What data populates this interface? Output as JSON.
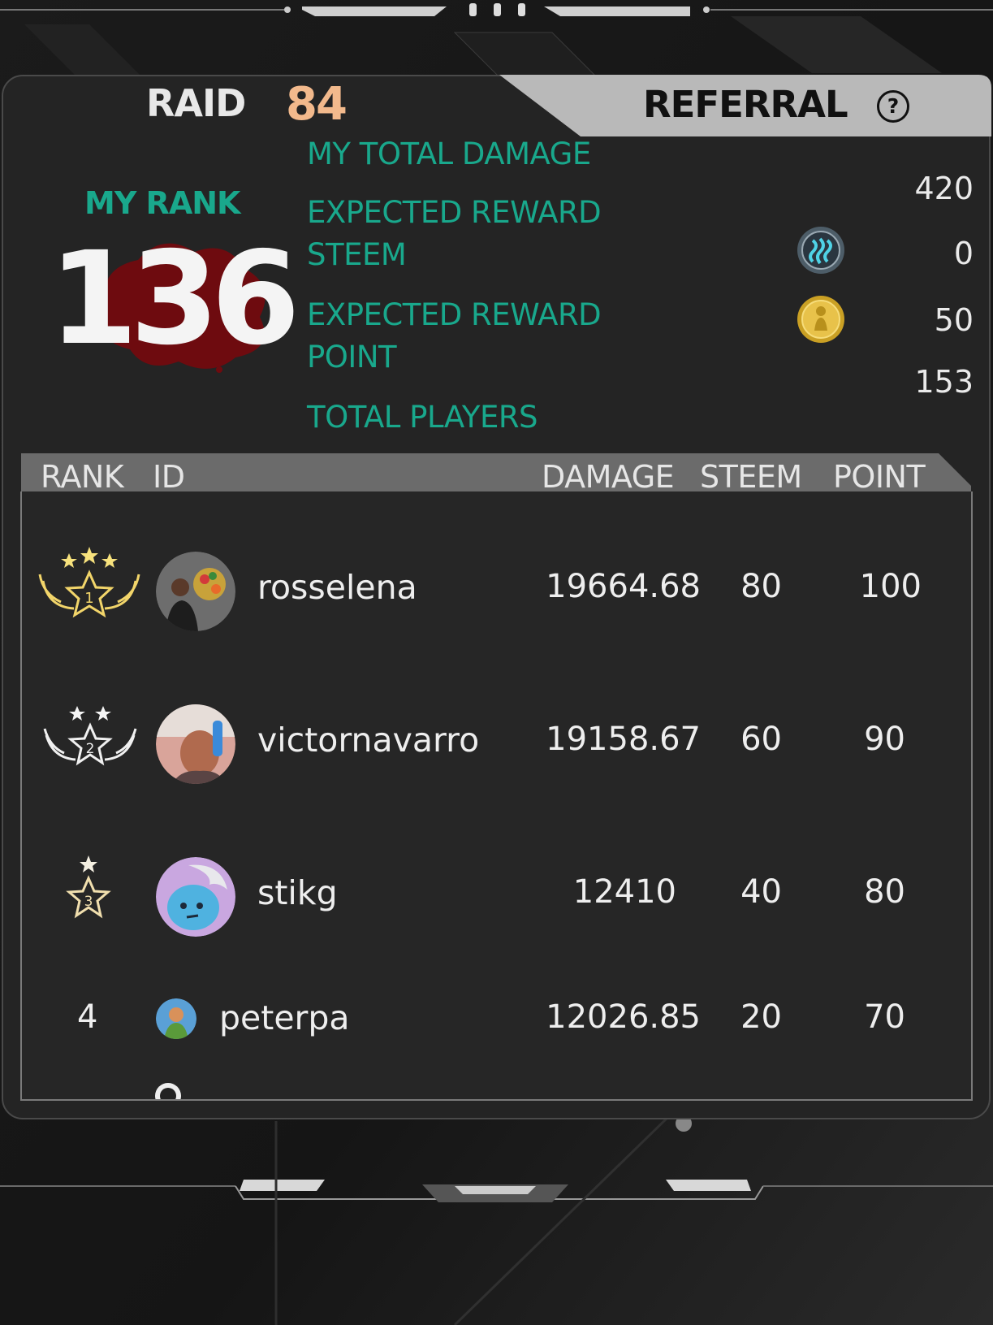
{
  "tabs": {
    "raid_label": "RAID",
    "raid_number": "84",
    "referral_label": "REFERRAL",
    "help_icon": "?"
  },
  "summary": {
    "my_rank_label": "MY RANK",
    "my_rank_value": "136",
    "total_damage_label": "MY TOTAL DAMAGE",
    "total_damage_value": "420",
    "reward_steem_label_1": "EXPECTED REWARD",
    "reward_steem_label_2": "STEEM",
    "reward_steem_value": "0",
    "reward_steem_icon": "steem-coin-icon",
    "reward_point_label_1": "EXPECTED REWARD",
    "reward_point_label_2": "POINT",
    "reward_point_value": "50",
    "reward_point_icon": "gold-point-coin-icon",
    "total_players_label": "TOTAL PLAYERS",
    "total_players_value": "153"
  },
  "table": {
    "columns": {
      "rank": "RANK",
      "id": "ID",
      "damage": "DAMAGE",
      "steem": "STEEM",
      "point": "POINT"
    },
    "rows": [
      {
        "rank": "1",
        "rank_icon": "gold-winged-star-badge-icon",
        "name": "rosselena",
        "damage": "19664.68",
        "steem": "80",
        "point": "100"
      },
      {
        "rank": "2",
        "rank_icon": "silver-winged-star-badge-icon",
        "name": "victornavarro",
        "damage": "19158.67",
        "steem": "60",
        "point": "90"
      },
      {
        "rank": "3",
        "rank_icon": "bronze-star-badge-icon",
        "name": "stikg",
        "damage": "12410",
        "steem": "40",
        "point": "80"
      },
      {
        "rank": "4",
        "name": "peterpa",
        "damage": "12026.85",
        "steem": "20",
        "point": "70"
      }
    ]
  },
  "colors": {
    "accent_teal": "#19a88c",
    "raid_orange": "#f2b98c",
    "gold": "#e8c24a",
    "panel": "#242424"
  }
}
